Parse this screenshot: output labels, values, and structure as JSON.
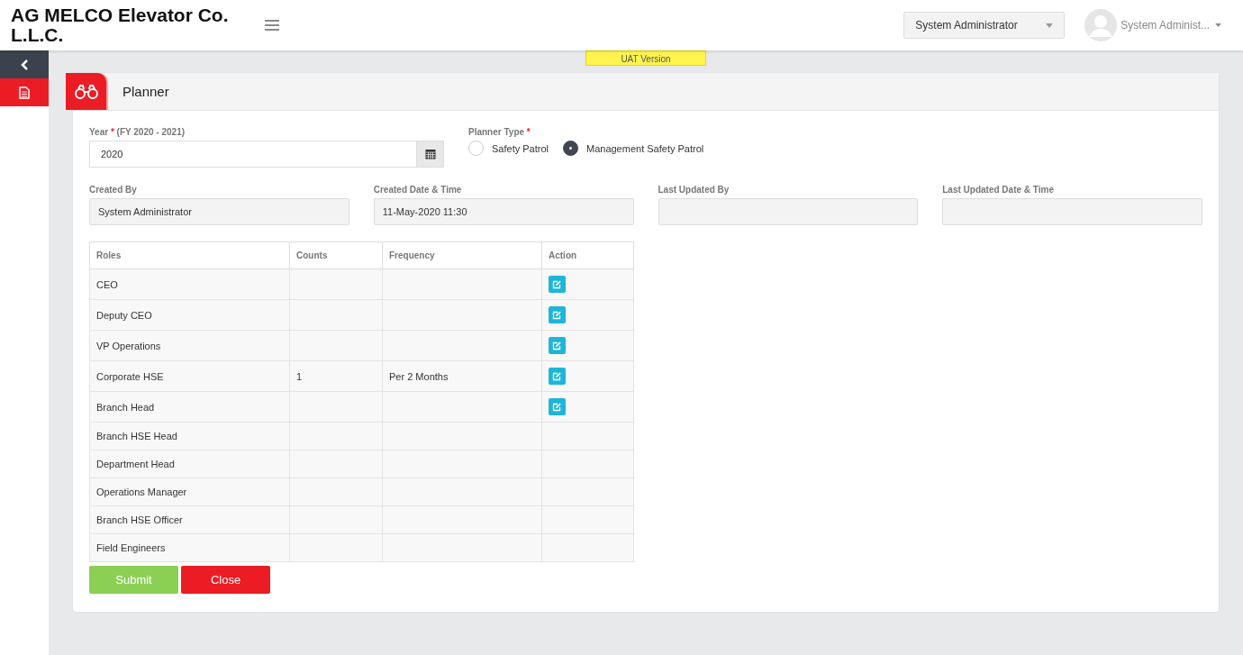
{
  "header": {
    "brand": "AG MELCO Elevator Co. L.L.C.",
    "role_select": "System Administrator",
    "user_name": "System Administ..."
  },
  "banner": "UAT Version",
  "sidebar": {
    "items": [
      {
        "kind": "collapse",
        "selected": false
      },
      {
        "kind": "document",
        "selected": true
      }
    ]
  },
  "page": {
    "title": "Planner"
  },
  "form": {
    "year": {
      "label": "Year",
      "required_mark": "*",
      "note": "(FY 2020 - 2021)",
      "value": "2020"
    },
    "planner_type": {
      "label": "Planner Type",
      "required_mark": "*",
      "options": [
        {
          "label": "Safety Patrol",
          "selected": false
        },
        {
          "label": "Management Safety Patrol",
          "selected": true
        }
      ]
    },
    "info": [
      {
        "label": "Created By",
        "value": "System Administrator"
      },
      {
        "label": "Created Date & Time",
        "value": "11-May-2020 11:30"
      },
      {
        "label": "Last Updated By"
      },
      {
        "label": "Last Updated Date & Time"
      }
    ]
  },
  "table": {
    "columns": [
      "Roles",
      "Counts",
      "Frequency",
      "Action"
    ],
    "rows": [
      {
        "role": "CEO",
        "editable": true
      },
      {
        "role": "Deputy CEO",
        "editable": true
      },
      {
        "role": "VP Operations",
        "editable": true
      },
      {
        "role": "Corporate HSE",
        "count": "1",
        "frequency": "Per 2 Months",
        "editable": true
      },
      {
        "role": "Branch Head",
        "editable": true
      },
      {
        "role": "Branch HSE Head",
        "editable": false
      },
      {
        "role": "Department Head",
        "editable": false
      },
      {
        "role": "Operations Manager",
        "editable": false
      },
      {
        "role": "Branch HSE Officer",
        "editable": false
      },
      {
        "role": "Field Engineers",
        "editable": false
      }
    ]
  },
  "buttons": [
    {
      "kind": "submit",
      "label": "Submit"
    },
    {
      "kind": "close",
      "label": "Close"
    }
  ]
}
